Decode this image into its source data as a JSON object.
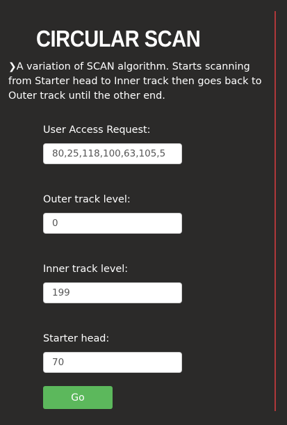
{
  "page": {
    "title": "CIRCULAR SCAN",
    "description": "A variation of SCAN algorithm. Starts scanning from Starter head to Inner track then goes back to Outer track until the other end.",
    "accent_color": "#b0383a",
    "background_color": "#2b2a29"
  },
  "form": {
    "user_access_request": {
      "label": "User Access Request:",
      "value": "80,25,118,100,63,105,5"
    },
    "outer_track": {
      "label": "Outer track level:",
      "value": "0"
    },
    "inner_track": {
      "label": "Inner track level:",
      "value": "199"
    },
    "starter_head": {
      "label": "Starter head:",
      "value": "70"
    },
    "go_label": "Go",
    "go_color": "#5cb85c"
  },
  "icons": {
    "description_bullet": "chevron-right-icon"
  }
}
